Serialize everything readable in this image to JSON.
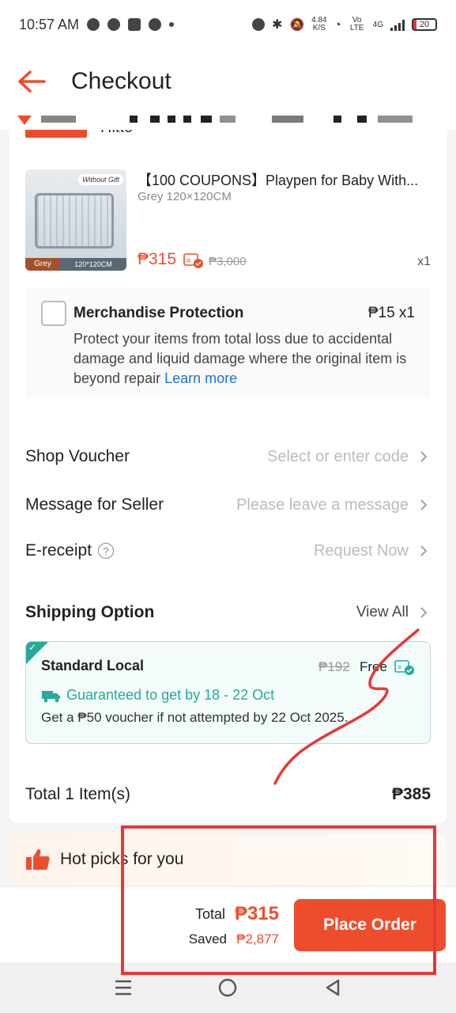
{
  "status_bar": {
    "time": "10:57 AM",
    "net_speed_value": "4.84",
    "net_speed_unit": "K/S",
    "volte": "Vo LTE",
    "network": "4G",
    "battery": "20"
  },
  "header": {
    "title": "Checkout"
  },
  "product": {
    "title": "【100 COUPONS】Playpen for Baby With...",
    "variant": "Grey 120×120CM",
    "price": "₱315",
    "original_price": "₱3,000",
    "quantity": "x1",
    "image_tag": "Without Gift",
    "image_color_label": "Grey",
    "image_size_label": "120*120CM"
  },
  "protection": {
    "title": "Merchandise Protection",
    "price": "₱15  x1",
    "description": "Protect your items from total loss due to accidental damage and liquid damage where the original item is beyond repair",
    "learn_more": "Learn more",
    "checked": false
  },
  "rows": {
    "voucher_label": "Shop Voucher",
    "voucher_placeholder": "Select or enter code",
    "message_label": "Message for Seller",
    "message_placeholder": "Please leave a message",
    "ereceipt_label": "E-receipt",
    "ereceipt_value": "Request Now"
  },
  "shipping": {
    "heading": "Shipping Option",
    "view_all": "View All",
    "name": "Standard Local",
    "original_fee": "₱192",
    "fee": "Free",
    "guarantee": "Guaranteed to get by 18 - 22 Oct",
    "note": "Get a ₱50 voucher if not attempted by 22 Oct 2025."
  },
  "order_total": {
    "label": "Total 1 Item(s)",
    "value": "₱385"
  },
  "hot_picks": {
    "label": "Hot picks for you"
  },
  "bottom": {
    "total_label": "Total",
    "total_value": "₱315",
    "saved_label": "Saved",
    "saved_value": "₱2,877",
    "place_order": "Place Order"
  },
  "colors": {
    "brand": "#ee4d2d",
    "teal": "#26aa99",
    "link": "#1976d2",
    "annotation": "#e53935"
  }
}
